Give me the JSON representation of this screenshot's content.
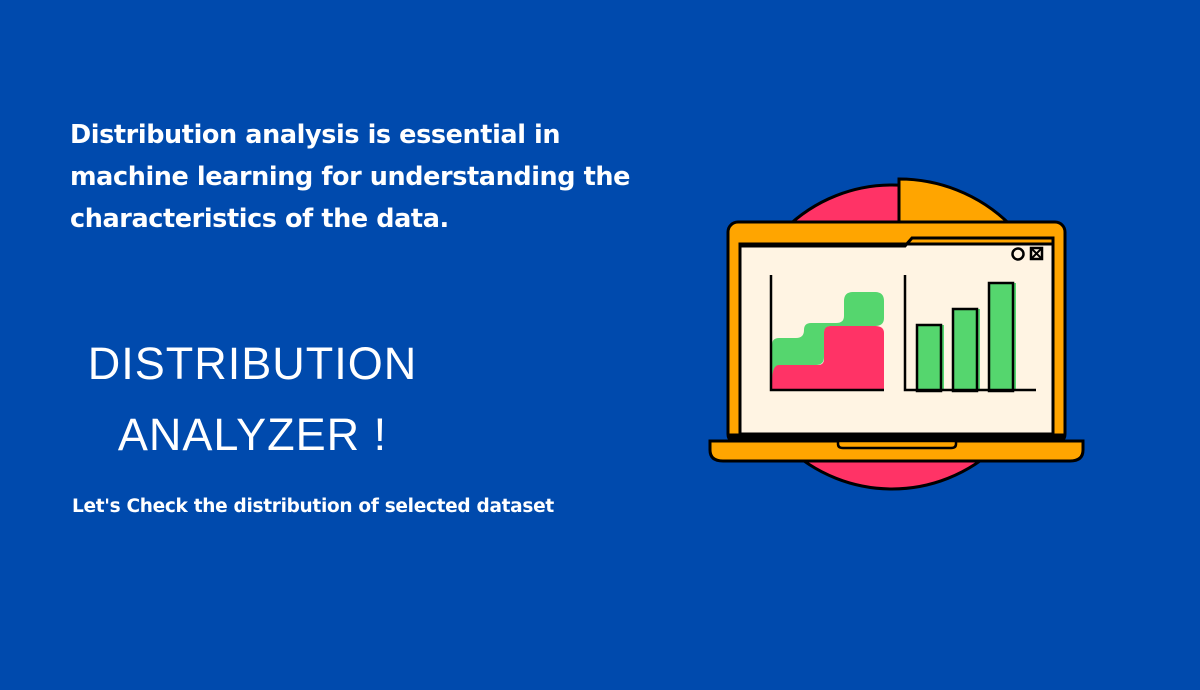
{
  "intro": {
    "line_1": "Distribution analysis is essential in",
    "line_2": "machine learning for understanding the",
    "line_3": "characteristics of the data."
  },
  "headline": {
    "line_1": "DISTRIBUTION",
    "line_2": "ANALYZER !"
  },
  "tagline": "Let's Check the distribution of selected dataset",
  "icons": {
    "illustration": "laptop-with-charts-icon",
    "window_circle": "circle-icon",
    "window_close": "close-icon"
  },
  "colors": {
    "background": "#004AAD",
    "text": "#FFFFFF",
    "laptop_orange": "#FFA500",
    "pie_pink": "#FF3366",
    "bar_green": "#55D66E",
    "screen_cream": "#FFF4E3",
    "outline": "#000000"
  }
}
